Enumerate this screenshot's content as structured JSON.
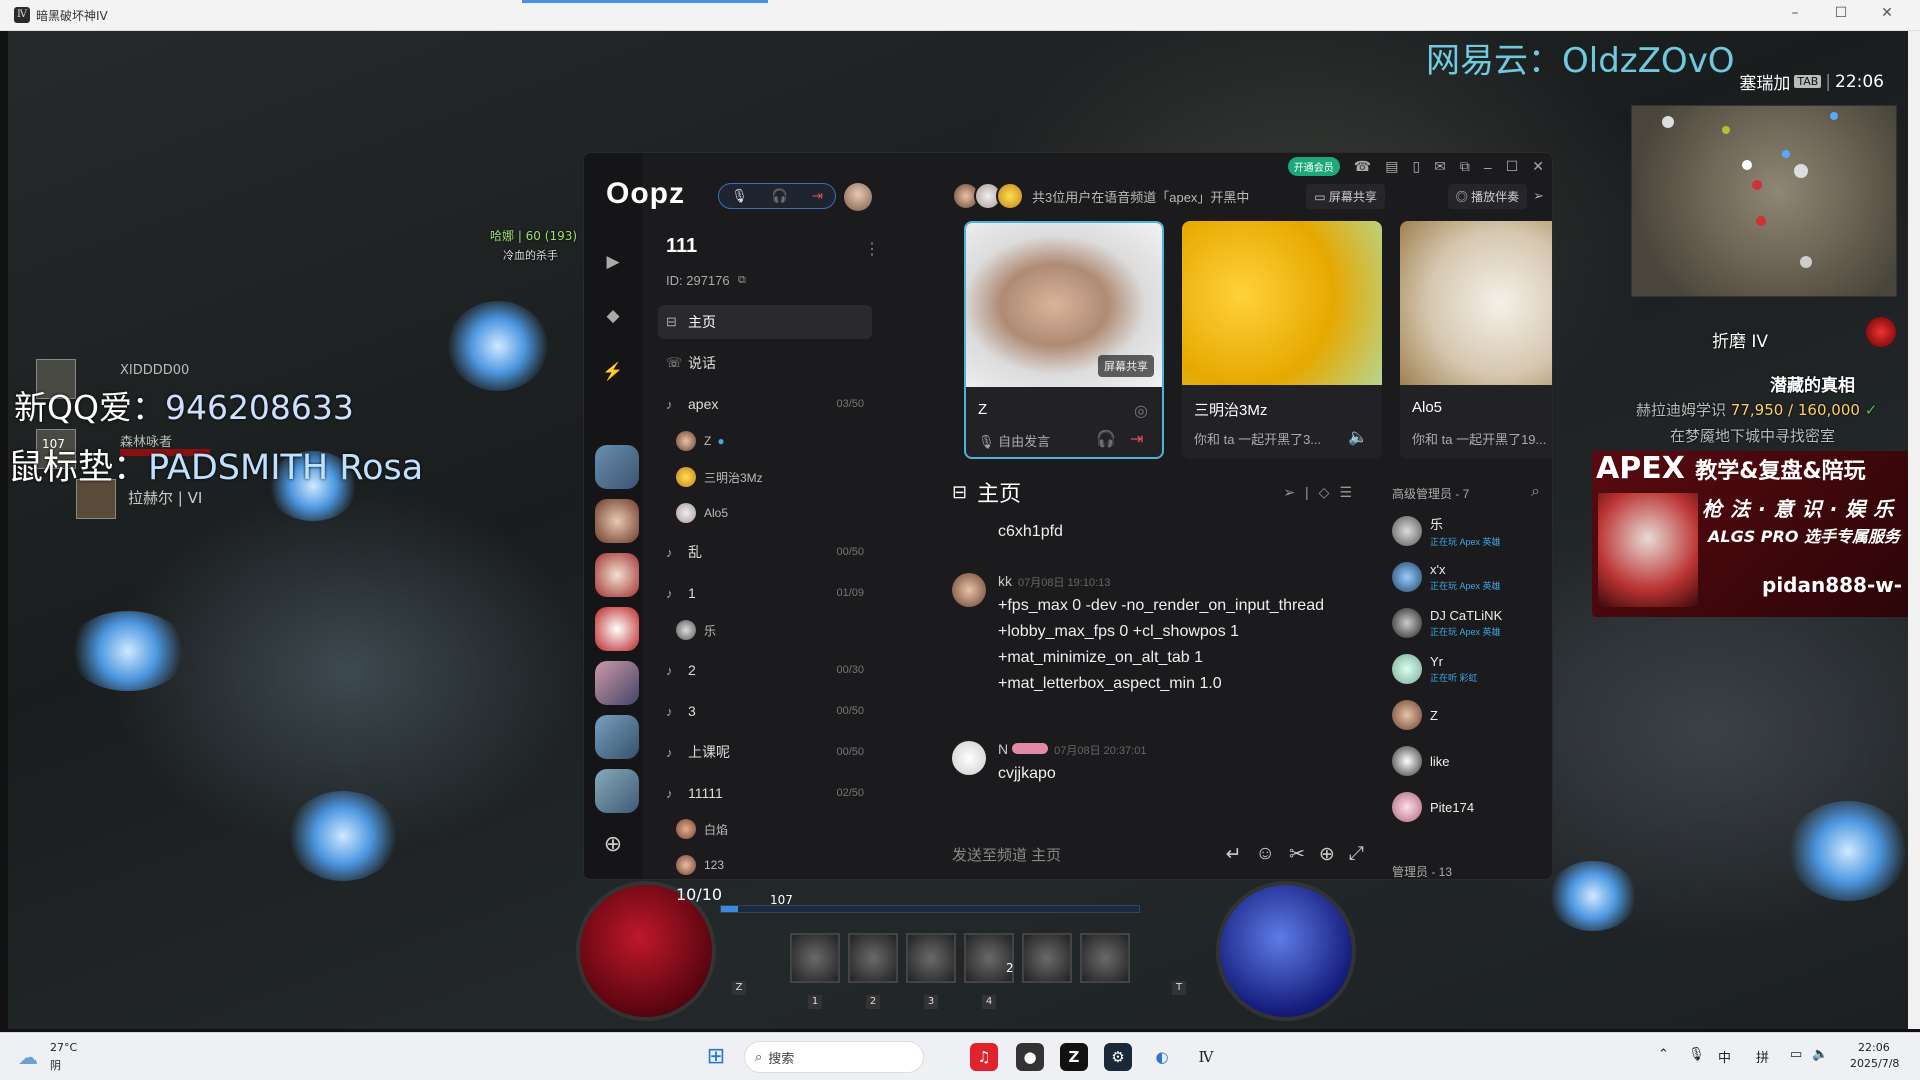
{
  "window": {
    "title": "暗黑破坏神IV"
  },
  "overlay": {
    "netease": "网易云：OldzZOvO",
    "qq_prefix": "新QQ爱：",
    "qq_value": "946208633",
    "mouse_prefix": "鼠标垫：",
    "mouse_value": "PADSMITH Rosa",
    "location": "塞瑞加",
    "tab_key": "TAB",
    "clock": "22:06"
  },
  "game": {
    "npc_name": "哈娜 | 60 (193)",
    "npc_title": "冷血的杀手",
    "party_player": "XIDDDD00",
    "party_player2": "森林咏者",
    "party_level": "107",
    "party_player3": "拉赫尔 | VI",
    "torment": "折磨 IV",
    "quest_title": "潜藏的真相",
    "quest_progress_label": "赫拉迪姆学识",
    "quest_progress": "77,950 / 160,000",
    "quest_sub": "在梦魇地下城中寻找密室",
    "health_text": "10/10",
    "char_level": "107",
    "skill_keys": [
      "1",
      "2",
      "3",
      "4"
    ],
    "skill_charge": "2",
    "left_key": "Z",
    "right_key": "T"
  },
  "apex_banner": {
    "title": "APEX",
    "title_suffix": "教学&复盘&陪玩",
    "line2": "枪法·意识·娱乐",
    "line3": "ALGS PRO 选手专属服务",
    "contact": "pidan888-w-"
  },
  "oopz": {
    "logo": "Oopz",
    "vip_label": "开通会员",
    "server_name": "111",
    "server_id": "ID: 297176",
    "channels": [
      {
        "icon": "home",
        "label": "主页",
        "count": ""
      },
      {
        "icon": "chat",
        "label": "说话",
        "count": ""
      },
      {
        "icon": "voice",
        "label": "apex",
        "count": "03/50"
      },
      {
        "icon": "voice",
        "label": "乱",
        "count": "00/50"
      },
      {
        "icon": "voice",
        "label": "1",
        "count": "01/09"
      },
      {
        "icon": "voice",
        "label": "2",
        "count": "00/30"
      },
      {
        "icon": "voice",
        "label": "3",
        "count": "00/50"
      },
      {
        "icon": "voice",
        "label": "上课呢",
        "count": "00/50"
      },
      {
        "icon": "voice",
        "label": "11111",
        "count": "02/50"
      }
    ],
    "apex_members": [
      "Z",
      "三明治3Mz",
      "Alo5"
    ],
    "ch1_members": [
      "乐"
    ],
    "ch11111_members": [
      "白焰",
      "123"
    ],
    "voice_status": "共3位用户在语音频道「apex」开黑中",
    "screen_share": "屏幕共享",
    "play_together": "播放伴奏",
    "cards": [
      {
        "name": "Z",
        "sub": "自由发言",
        "badge": "屏幕共享"
      },
      {
        "name": "三明治3Mz",
        "sub": "你和 ta 一起开黑了3...",
        "badge": ""
      },
      {
        "name": "Alo5",
        "sub": "你和 ta 一起开黑了19...",
        "badge": ""
      }
    ],
    "chat": {
      "title": "主页",
      "first_line": "c6xh1pfd",
      "msg1": {
        "author": "kk",
        "time": "07月08日 19:10:13",
        "lines": [
          "+fps_max 0 -dev -no_render_on_input_thread",
          "+lobby_max_fps 0 +cl_showpos 1",
          "+mat_minimize_on_alt_tab 1",
          "+mat_letterbox_aspect_min 1.0"
        ]
      },
      "msg2": {
        "author": "N",
        "time": "07月08日 20:37:01",
        "lines": [
          "cvjjkapo"
        ]
      },
      "input_placeholder": "发送至频道 主页"
    },
    "members": {
      "header": "高级管理员 - 7",
      "footer": "管理员 - 13",
      "list": [
        {
          "name": "乐",
          "status": "正在玩 Apex 英雄"
        },
        {
          "name": "x'x",
          "status": "正在玩 Apex 英雄"
        },
        {
          "name": "DJ CaTLiNK",
          "status": "正在玩 Apex 英雄"
        },
        {
          "name": "Yr",
          "status": "正在听 彩虹"
        },
        {
          "name": "Z",
          "status": ""
        },
        {
          "name": "like",
          "status": ""
        },
        {
          "name": "Pite174",
          "status": ""
        }
      ]
    }
  },
  "taskbar": {
    "weather_temp": "27°C",
    "weather_desc": "阴",
    "search_placeholder": "搜索",
    "time": "22:06",
    "date": "2025/7/8",
    "ime1": "中",
    "ime2": "拼"
  }
}
